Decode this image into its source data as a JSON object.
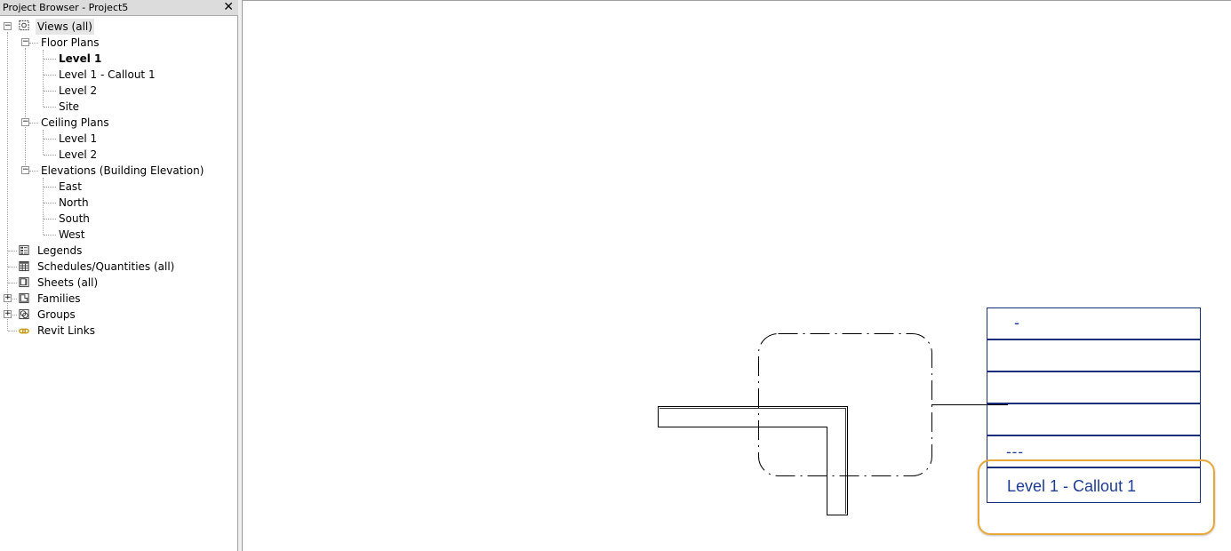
{
  "browser": {
    "title": "Project Browser - Project5",
    "close_glyph": "✕",
    "tree": {
      "views_all": "Views (all)",
      "floor_plans": {
        "label": "Floor Plans",
        "items": [
          "Level 1",
          "Level 1 - Callout 1",
          "Level 2",
          "Site"
        ]
      },
      "ceiling_plans": {
        "label": "Ceiling Plans",
        "items": [
          "Level 1",
          "Level 2"
        ]
      },
      "elevations": {
        "label": "Elevations (Building Elevation)",
        "items": [
          "East",
          "North",
          "South",
          "West"
        ]
      },
      "legends": "Legends",
      "schedules": "Schedules/Quantities (all)",
      "sheets": "Sheets (all)",
      "families": "Families",
      "groups": "Groups",
      "revit_links": "Revit Links"
    },
    "expander_minus": "−",
    "expander_plus": "+"
  },
  "drawing": {
    "tag_rows": [
      "-",
      "",
      "",
      "",
      "---",
      "Level 1 - Callout 1"
    ],
    "tag_color": "#1e3c96",
    "highlight_color": "#e8a838"
  }
}
